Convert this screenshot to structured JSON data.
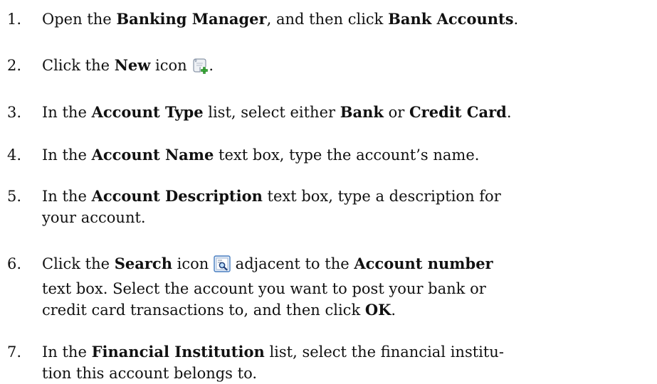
{
  "steps": [
    {
      "num": "1.",
      "parts": [
        "Open the ",
        "Banking Manager",
        ", and then click ",
        "Bank Accounts",
        "."
      ]
    },
    {
      "num": "2.",
      "parts": [
        "Click the ",
        "New",
        " icon ",
        "."
      ]
    },
    {
      "num": "3.",
      "parts": [
        "In the ",
        "Account Type",
        " list, select either ",
        "Bank",
        " or ",
        "Credit Card",
        "."
      ]
    },
    {
      "num": "4.",
      "parts": [
        "In the ",
        "Account Name",
        " text box, type the account’s name."
      ]
    },
    {
      "num": "5.",
      "line1": [
        "In the ",
        "Account Description",
        " text box, type a description for"
      ],
      "line2": "your account."
    },
    {
      "num": "6.",
      "line1": [
        "Click the ",
        "Search",
        " icon ",
        " adjacent to the ",
        "Account number"
      ],
      "line2": "text box. Select the account you want to post your bank or",
      "line3": [
        "credit card transactions to, and then click ",
        "OK",
        "."
      ]
    },
    {
      "num": "7.",
      "line1": [
        "In the ",
        "Financial Institution",
        " list, select the financial institu-"
      ],
      "line2": "tion this account belongs to."
    }
  ],
  "icons": {
    "new": "new-document-icon",
    "search": "search-lookup-icon"
  },
  "colors": {
    "text": "#111111",
    "icon_green": "#3aa83a",
    "icon_blue": "#4a7fc0"
  }
}
